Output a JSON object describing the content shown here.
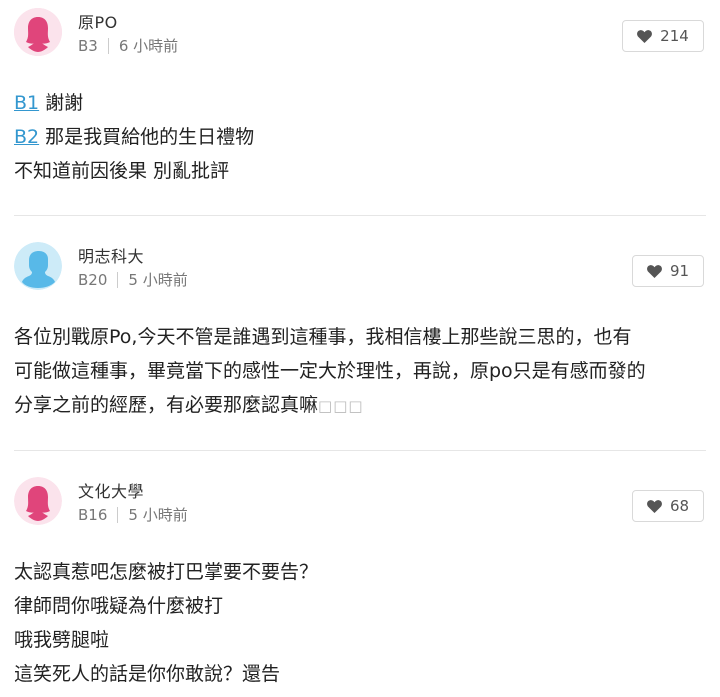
{
  "comments": [
    {
      "author": "原PO",
      "floor": "B3",
      "time": "6 小時前",
      "likes": "214",
      "avatar": "female-avatar",
      "avatar_color": "#e0457b",
      "lines": [
        {
          "link": "B1",
          "text": " 謝謝"
        },
        {
          "link": "B2",
          "text": " 那是我買給他的生日禮物"
        },
        {
          "link": "",
          "text": "不知道前因後果 別亂批評"
        }
      ]
    },
    {
      "author": "明志科大",
      "floor": "B20",
      "time": "5 小時前",
      "likes": "91",
      "avatar": "male-avatar",
      "avatar_color": "#58b9e8",
      "lines": [
        {
          "text": "各位別戰原Po,今天不管是誰遇到這種事，我相信樓上那些說三思的，也有"
        },
        {
          "text": "可能做這種事，畢竟當下的感性一定大於理性，再說，原po只是有感而發的"
        },
        {
          "text": "分享之前的經歷，有必要那麼認真嘛",
          "tofu": "□□□"
        }
      ]
    },
    {
      "author": "文化大學",
      "floor": "B16",
      "time": "5 小時前",
      "likes": "68",
      "avatar": "female-avatar",
      "avatar_color": "#e0457b",
      "lines": [
        {
          "text": "太認真惹吧怎麼被打巴掌要不要告？"
        },
        {
          "text": "律師問你哦疑為什麼被打"
        },
        {
          "text": "哦我劈腿啦"
        },
        {
          "text": "這笑死人的話是你你敢說？還告"
        }
      ]
    }
  ]
}
